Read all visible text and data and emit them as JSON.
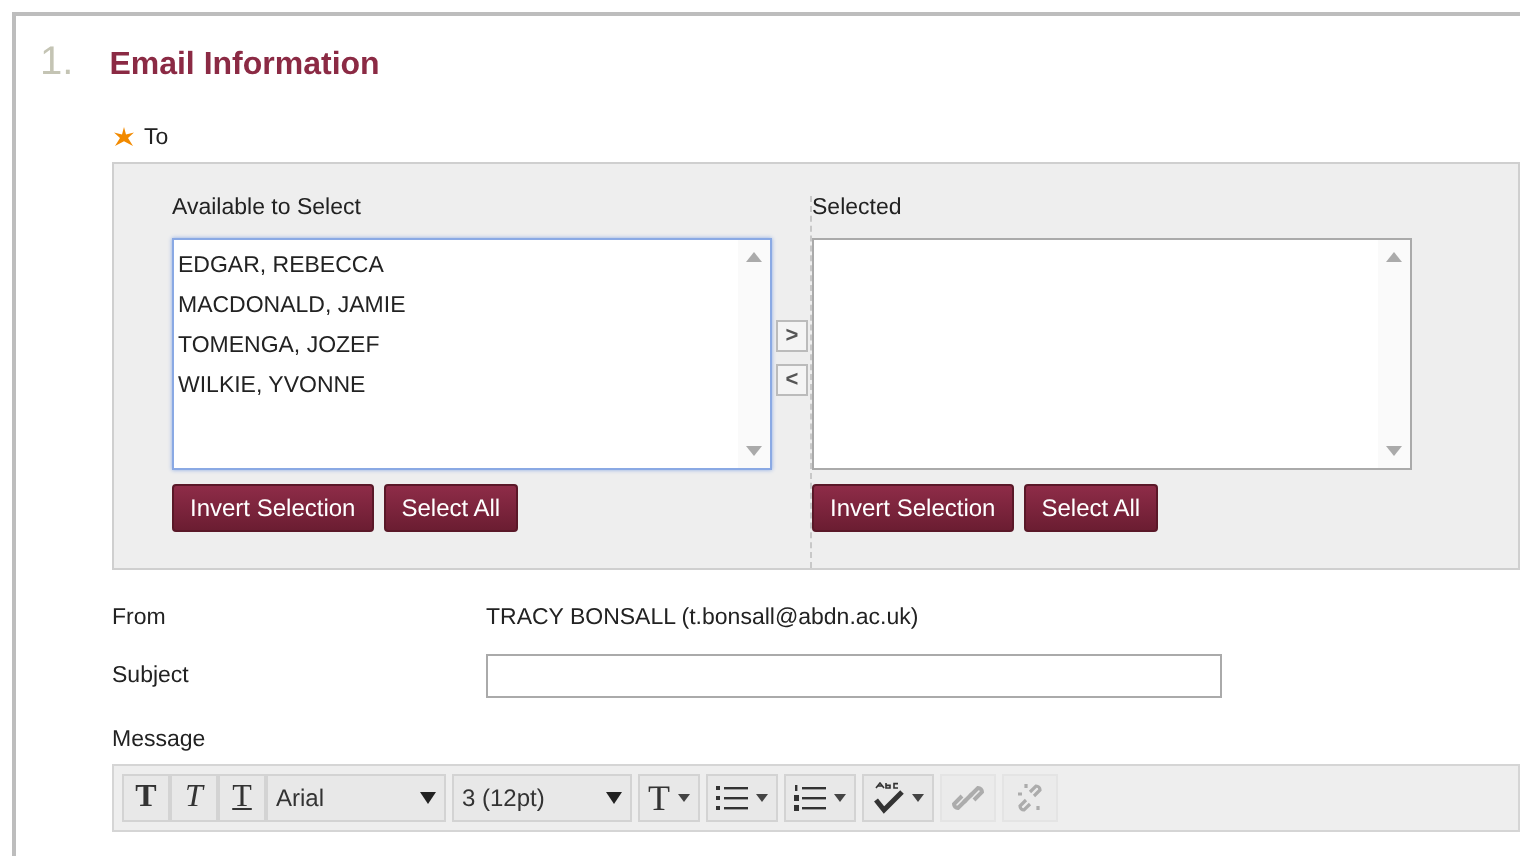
{
  "section": {
    "number": "1.",
    "title": "Email Information"
  },
  "to": {
    "label": "To",
    "required": true,
    "available": {
      "label": "Available to Select",
      "focused": true,
      "options": [
        "EDGAR, REBECCA",
        "MACDONALD, JAMIE",
        "TOMENGA, JOZEF",
        "WILKIE, YVONNE"
      ],
      "buttons": [
        "Invert Selection",
        "Select All"
      ]
    },
    "move_buttons": [
      ">",
      "<"
    ],
    "selected": {
      "label": "Selected",
      "focused": false,
      "buttons": [
        "Invert Selection",
        "Select All"
      ]
    }
  },
  "from": {
    "label": "From",
    "value": "TRACY BONSALL (t.bonsall@abdn.ac.uk)"
  },
  "subject": {
    "label": "Subject"
  },
  "message": {
    "label": "Message",
    "toolbar": [
      {
        "kind": "bold",
        "text": "T",
        "disabled": false
      },
      {
        "kind": "italic",
        "text": "T",
        "disabled": false
      },
      {
        "kind": "underline",
        "text": "T",
        "disabled": false
      },
      {
        "kind": "select",
        "value": "Arial",
        "disabled": false
      },
      {
        "kind": "select",
        "value": "3 (12pt)",
        "disabled": false
      },
      {
        "kind": "text-color",
        "text": "T",
        "disabled": false
      },
      {
        "kind": "bullet-list",
        "disabled": false
      },
      {
        "kind": "numbered-list",
        "disabled": false
      },
      {
        "kind": "spellcheck",
        "disabled": false
      },
      {
        "kind": "link",
        "disabled": true
      },
      {
        "kind": "unlink",
        "disabled": true
      }
    ]
  }
}
